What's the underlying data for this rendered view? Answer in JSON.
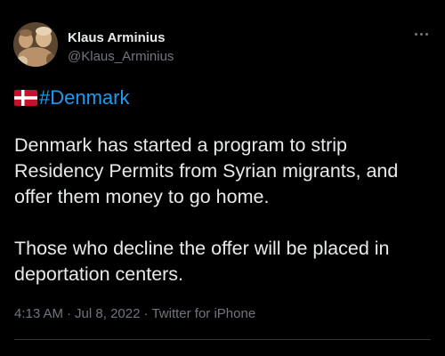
{
  "author": {
    "name": "Klaus Arminius",
    "handle": "@Klaus_Arminius"
  },
  "hashtag": "#Denmark",
  "flag_icon": "denmark-flag-icon",
  "paragraphs": [
    "Denmark has started a program to strip Residency Permits from Syrian migrants, and offer them money to go home.",
    "Those who decline the offer will be placed in deportation centers."
  ],
  "meta": {
    "time": "4:13 AM",
    "separator": "·",
    "date": "Jul 8, 2022",
    "client": "Twitter for iPhone"
  },
  "colors": {
    "background": "#000000",
    "text": "#e7e9ea",
    "muted": "#71767b",
    "link": "#1d9bf0",
    "divider": "#2f3336"
  }
}
